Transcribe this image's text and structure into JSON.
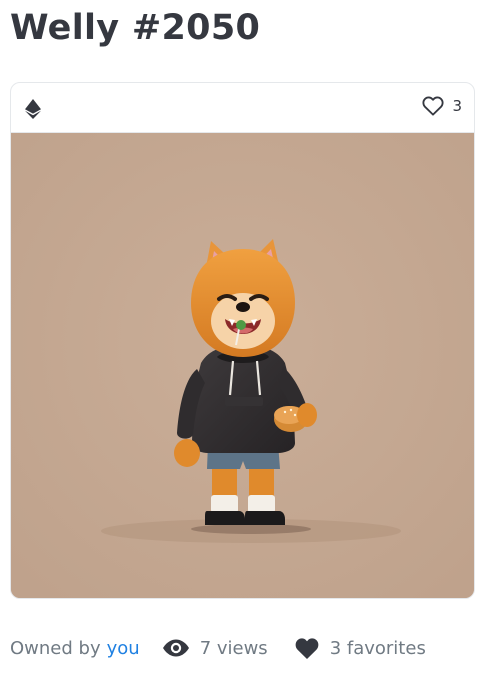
{
  "page": {
    "title": "Welly #2050"
  },
  "card": {
    "currency_icon": "ethereum-icon",
    "favorite_icon": "heart-outline-icon",
    "favorite_count": "3",
    "image_alt": "Welly figure"
  },
  "meta": {
    "owned_by_label": "Owned by",
    "owner": "you",
    "views_icon": "eye-icon",
    "views": "7 views",
    "favorites_icon": "heart-filled-icon",
    "favorites": "3 favorites"
  },
  "colors": {
    "text": "#353840",
    "muted": "#707a83",
    "link": "#2081e2",
    "art_background": "#c4a892",
    "border": "#e5e8eb"
  }
}
